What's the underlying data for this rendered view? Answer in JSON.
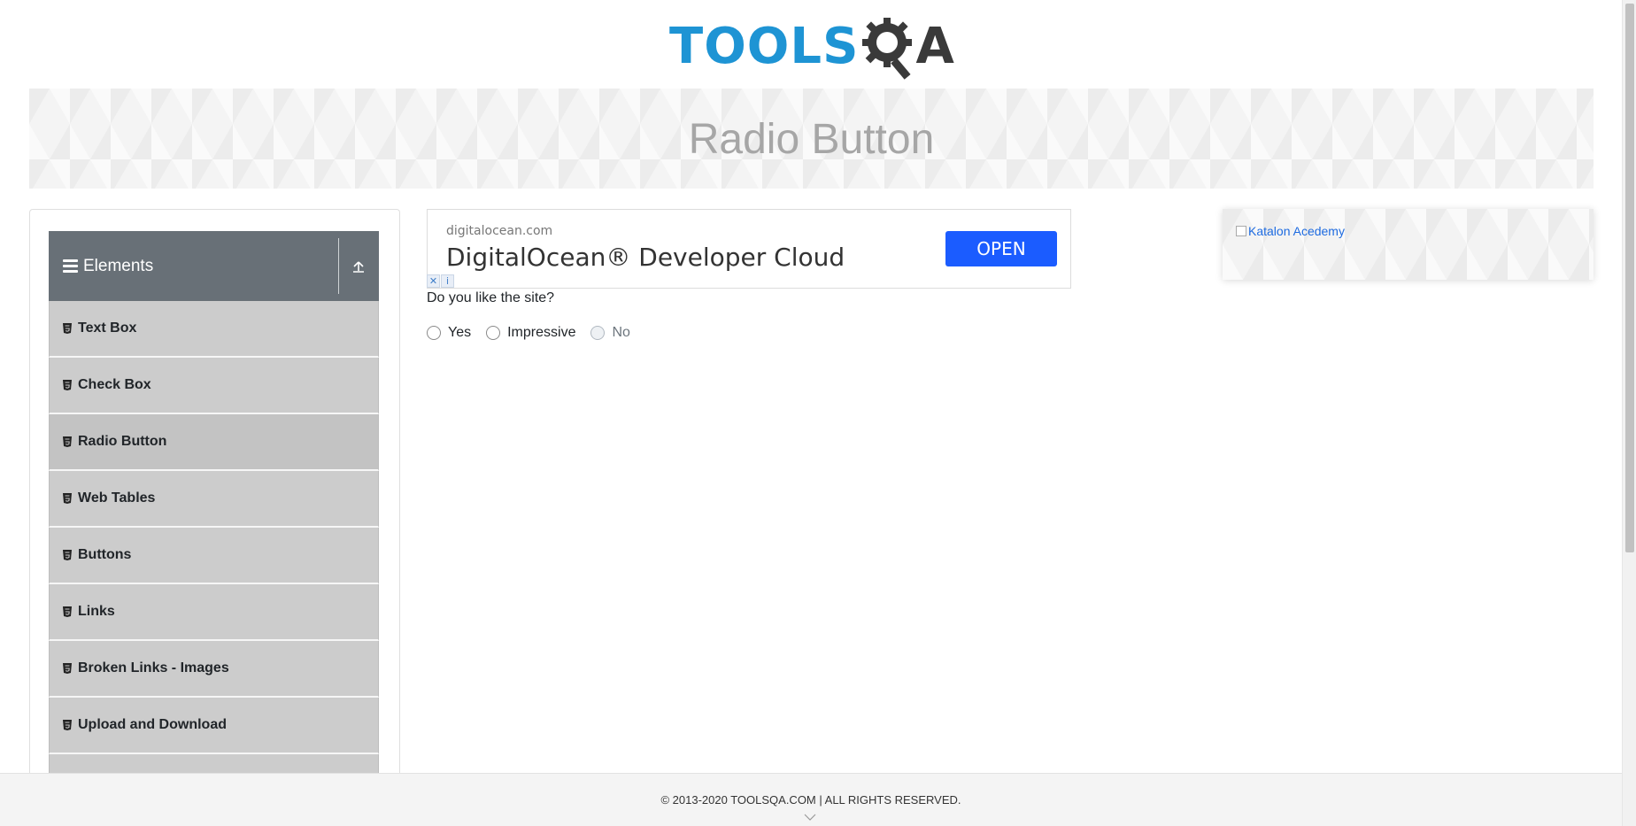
{
  "header": {
    "logo_text_left": "TOOLS",
    "logo_text_right": "A",
    "brand_colors": {
      "blue": "#1e94d4",
      "dark": "#3a3a3a"
    }
  },
  "banner": {
    "title": "Radio Button"
  },
  "sidebar": {
    "group": {
      "title": "Elements",
      "icon": "hamburger-icon",
      "collapse_icon": "arrow-up-icon"
    },
    "items": [
      {
        "label": "Text Box",
        "icon": "html5-icon",
        "active": false
      },
      {
        "label": "Check Box",
        "icon": "html5-icon",
        "active": false
      },
      {
        "label": "Radio Button",
        "icon": "html5-icon",
        "active": true
      },
      {
        "label": "Web Tables",
        "icon": "html5-icon",
        "active": false
      },
      {
        "label": "Buttons",
        "icon": "html5-icon",
        "active": false
      },
      {
        "label": "Links",
        "icon": "html5-icon",
        "active": false
      },
      {
        "label": "Broken Links - Images",
        "icon": "html5-icon",
        "active": false
      },
      {
        "label": "Upload and Download",
        "icon": "html5-icon",
        "active": false
      },
      {
        "label": "",
        "icon": "html5-icon",
        "active": false
      }
    ]
  },
  "ad": {
    "domain": "digitalocean.com",
    "title": "DigitalOcean® Developer Cloud",
    "cta": "OPEN",
    "cta_color": "#1b5cff",
    "close_glyph": "✕",
    "info_glyph": "i"
  },
  "main": {
    "question": "Do you like the site?",
    "options": [
      {
        "label": "Yes",
        "disabled": false,
        "checked": false
      },
      {
        "label": "Impressive",
        "disabled": false,
        "checked": false
      },
      {
        "label": "No",
        "disabled": true,
        "checked": false
      }
    ]
  },
  "right_ad": {
    "alt_text": "Katalon Acedemy"
  },
  "footer": {
    "copyright": "© 2013-2020 TOOLSQA.COM | ALL RIGHTS RESERVED."
  }
}
